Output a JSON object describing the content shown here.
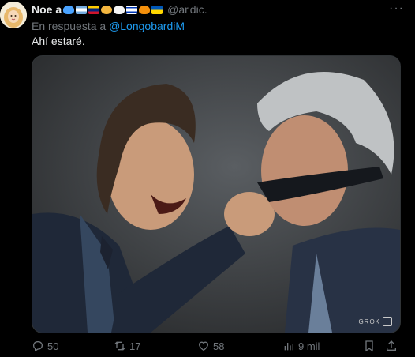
{
  "tweet": {
    "author_name": "Noe   a",
    "handle_fragment": "@ar    ",
    "time_fragment": "dic.",
    "more_label": "···",
    "reply_prefix": "En respuesta a",
    "reply_to": "@LongobardiM",
    "text": "Ahí estaré.",
    "media_watermark": "GROK",
    "emoji_icons": [
      "blue-heart",
      "argentina-flag",
      "venezuela-flag",
      "cat-face",
      "white-heart",
      "israel-flag",
      "orange-heart",
      "ukraine-flag"
    ]
  },
  "actions": {
    "replies": "50",
    "reposts": "17",
    "likes": "58",
    "views": "9 mil"
  },
  "colors": {
    "background": "#000000",
    "text": "#e7e9ea",
    "muted": "#71767b",
    "link": "#1d9bf0"
  }
}
